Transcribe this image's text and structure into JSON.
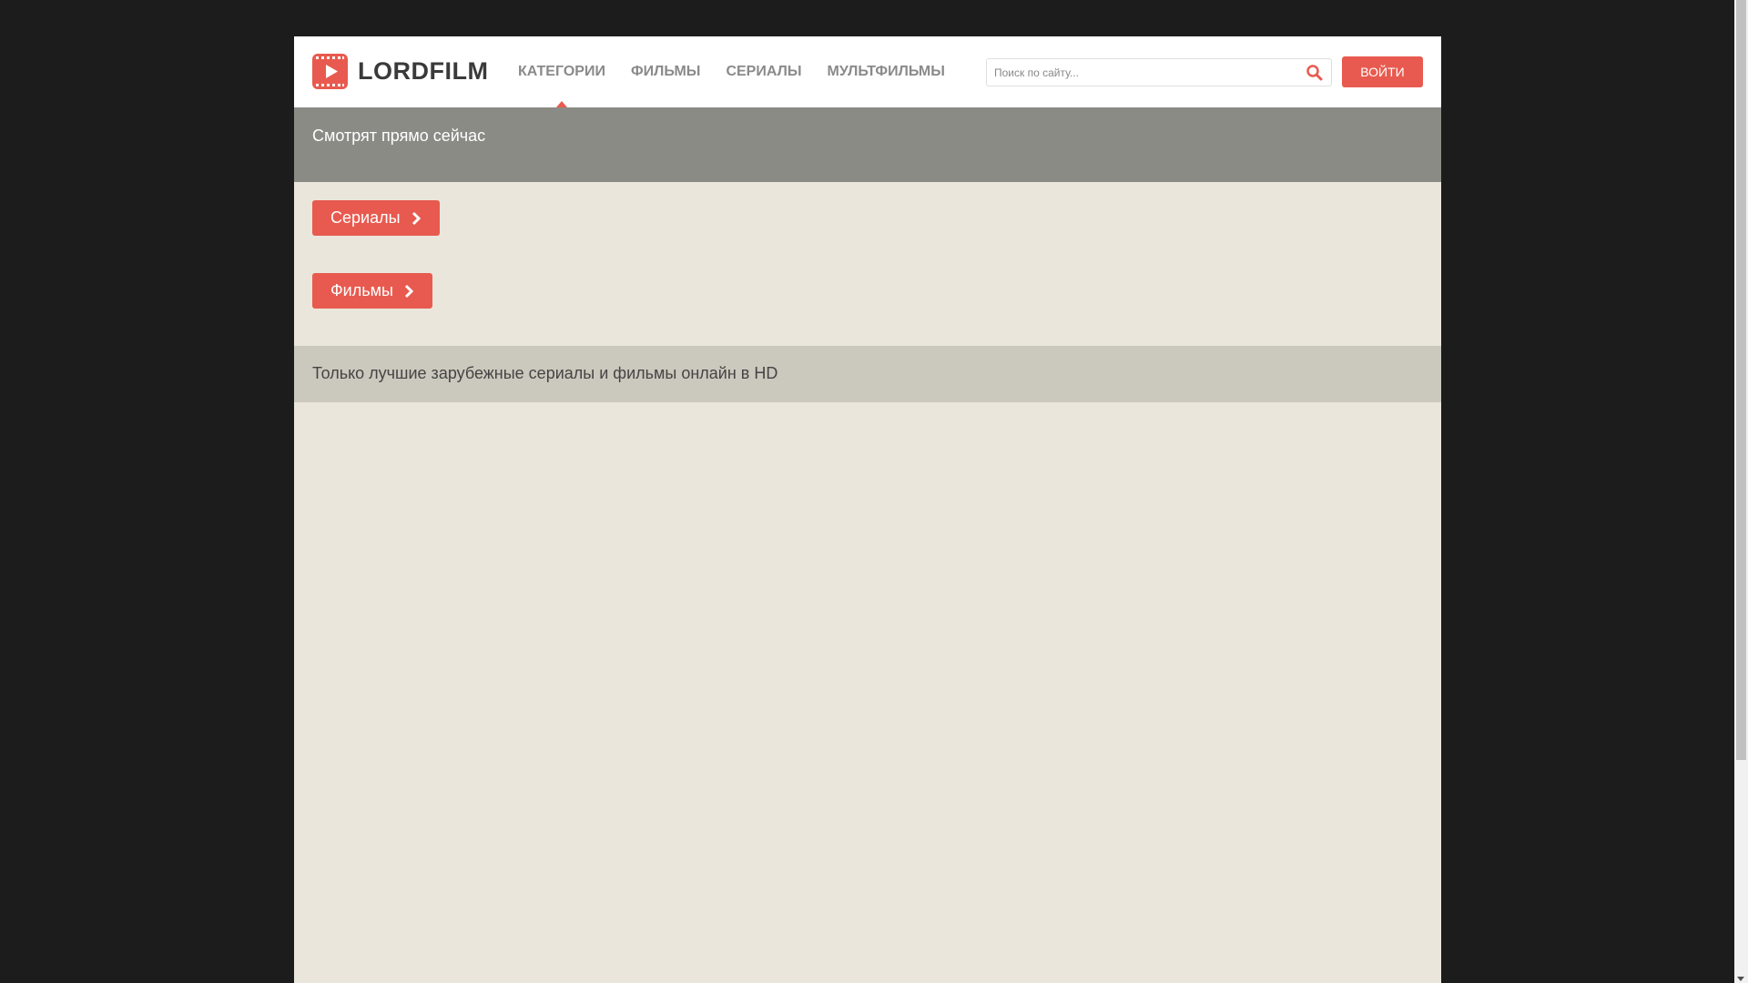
{
  "site": {
    "logo_text": "LORDFILM"
  },
  "nav": {
    "items": [
      {
        "label": "КАТЕГОРИИ"
      },
      {
        "label": "ФИЛЬМЫ"
      },
      {
        "label": "СЕРИАЛЫ"
      },
      {
        "label": "МУЛЬТФИЛЬМЫ"
      }
    ]
  },
  "search": {
    "placeholder": "Поиск по сайту...",
    "value": ""
  },
  "header": {
    "login_label": "ВОЙТИ"
  },
  "now_watching": {
    "title": "Смотрят прямо сейчас"
  },
  "categories": {
    "serials_label": "Сериалы",
    "films_label": "Фильмы"
  },
  "tagline": {
    "text": "Только лучшие зарубежные сериалы и фильмы онлайн в HD"
  },
  "colors": {
    "accent": "#e85a4f",
    "page_bg": "#eae6dc",
    "outer_bg": "#1c1c1c",
    "now_watching_bg": "#8b8b86",
    "tagline_bg": "#cbc8bd"
  },
  "icons": {
    "logo": "play-film-icon",
    "search": "search-icon",
    "chevron": "chevron-right-icon"
  }
}
